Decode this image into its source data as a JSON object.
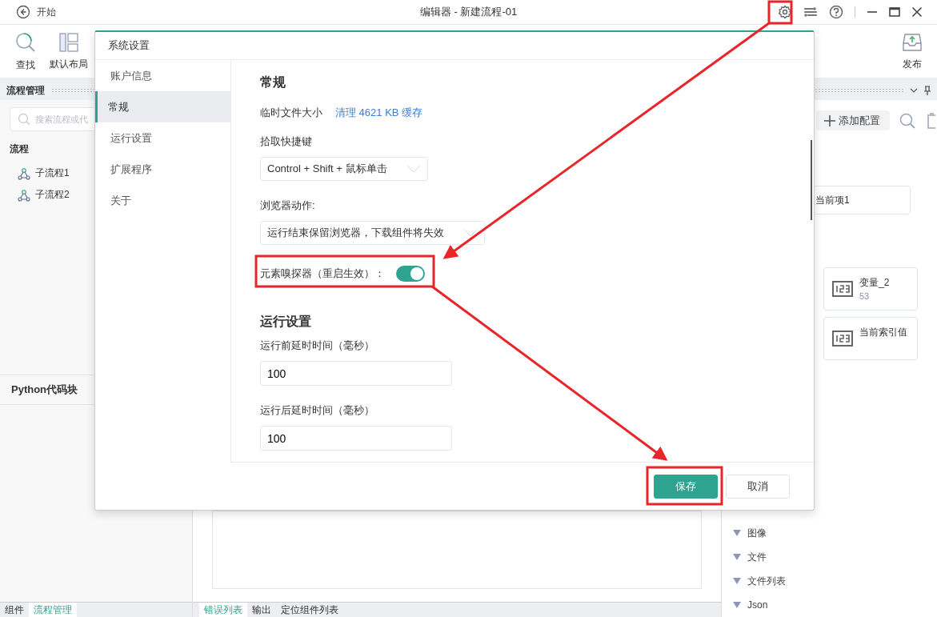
{
  "window": {
    "back_label": "开始",
    "title": "编辑器 - 新建流程-01"
  },
  "toolbar": {
    "find": "查找",
    "layout": "默认布局",
    "publish": "发布"
  },
  "left_panel": {
    "title": "流程管理",
    "search_placeholder": "搜索流程或代",
    "section": "流程",
    "items": [
      "子流程1",
      "子流程2"
    ],
    "code_section": "Python代码块",
    "tabs": [
      {
        "label": "组件",
        "selected": false
      },
      {
        "label": "流程管理",
        "selected": true
      }
    ]
  },
  "bottom_tabs": [
    {
      "label": "错误列表",
      "selected": true
    },
    {
      "label": "输出",
      "selected": false
    },
    {
      "label": "定位组件列表",
      "selected": false
    }
  ],
  "right_panel": {
    "add_button": "添加配置",
    "partial_item": "当前项1",
    "variables": [
      {
        "name": "变量_2",
        "value": "53"
      },
      {
        "name": "当前索引值"
      }
    ],
    "tree": [
      "图像",
      "文件",
      "文件列表",
      "Json"
    ]
  },
  "dialog": {
    "title": "系统设置",
    "nav": [
      {
        "label": "账户信息",
        "selected": false
      },
      {
        "label": "常规",
        "selected": true
      },
      {
        "label": "运行设置",
        "selected": false
      },
      {
        "label": "扩展程序",
        "selected": false
      },
      {
        "label": "关于",
        "selected": false
      }
    ],
    "settings": [
      {
        "kind": "heading",
        "label": "常规"
      },
      {
        "kind": "link",
        "label": "临时文件大小",
        "value": "清理 4621 KB 缓存"
      },
      {
        "kind": "select",
        "label": "拾取快捷键",
        "value": "Control + Shift + 鼠标单击"
      },
      {
        "kind": "select",
        "label": "浏览器动作:",
        "value": "运行结束保留浏览器，下载组件将失效"
      },
      {
        "kind": "toggle",
        "label": "元素嗅探器（重启生效）：",
        "on": true
      },
      {
        "kind": "heading",
        "label": "运行设置"
      },
      {
        "kind": "input",
        "label": "运行前延时时间（毫秒）",
        "value": "100"
      },
      {
        "kind": "input",
        "label": "运行后延时时间（毫秒）",
        "value": "100"
      }
    ],
    "buttons": [
      {
        "label": "保存",
        "primary": true
      },
      {
        "label": "取消",
        "primary": false
      }
    ]
  }
}
